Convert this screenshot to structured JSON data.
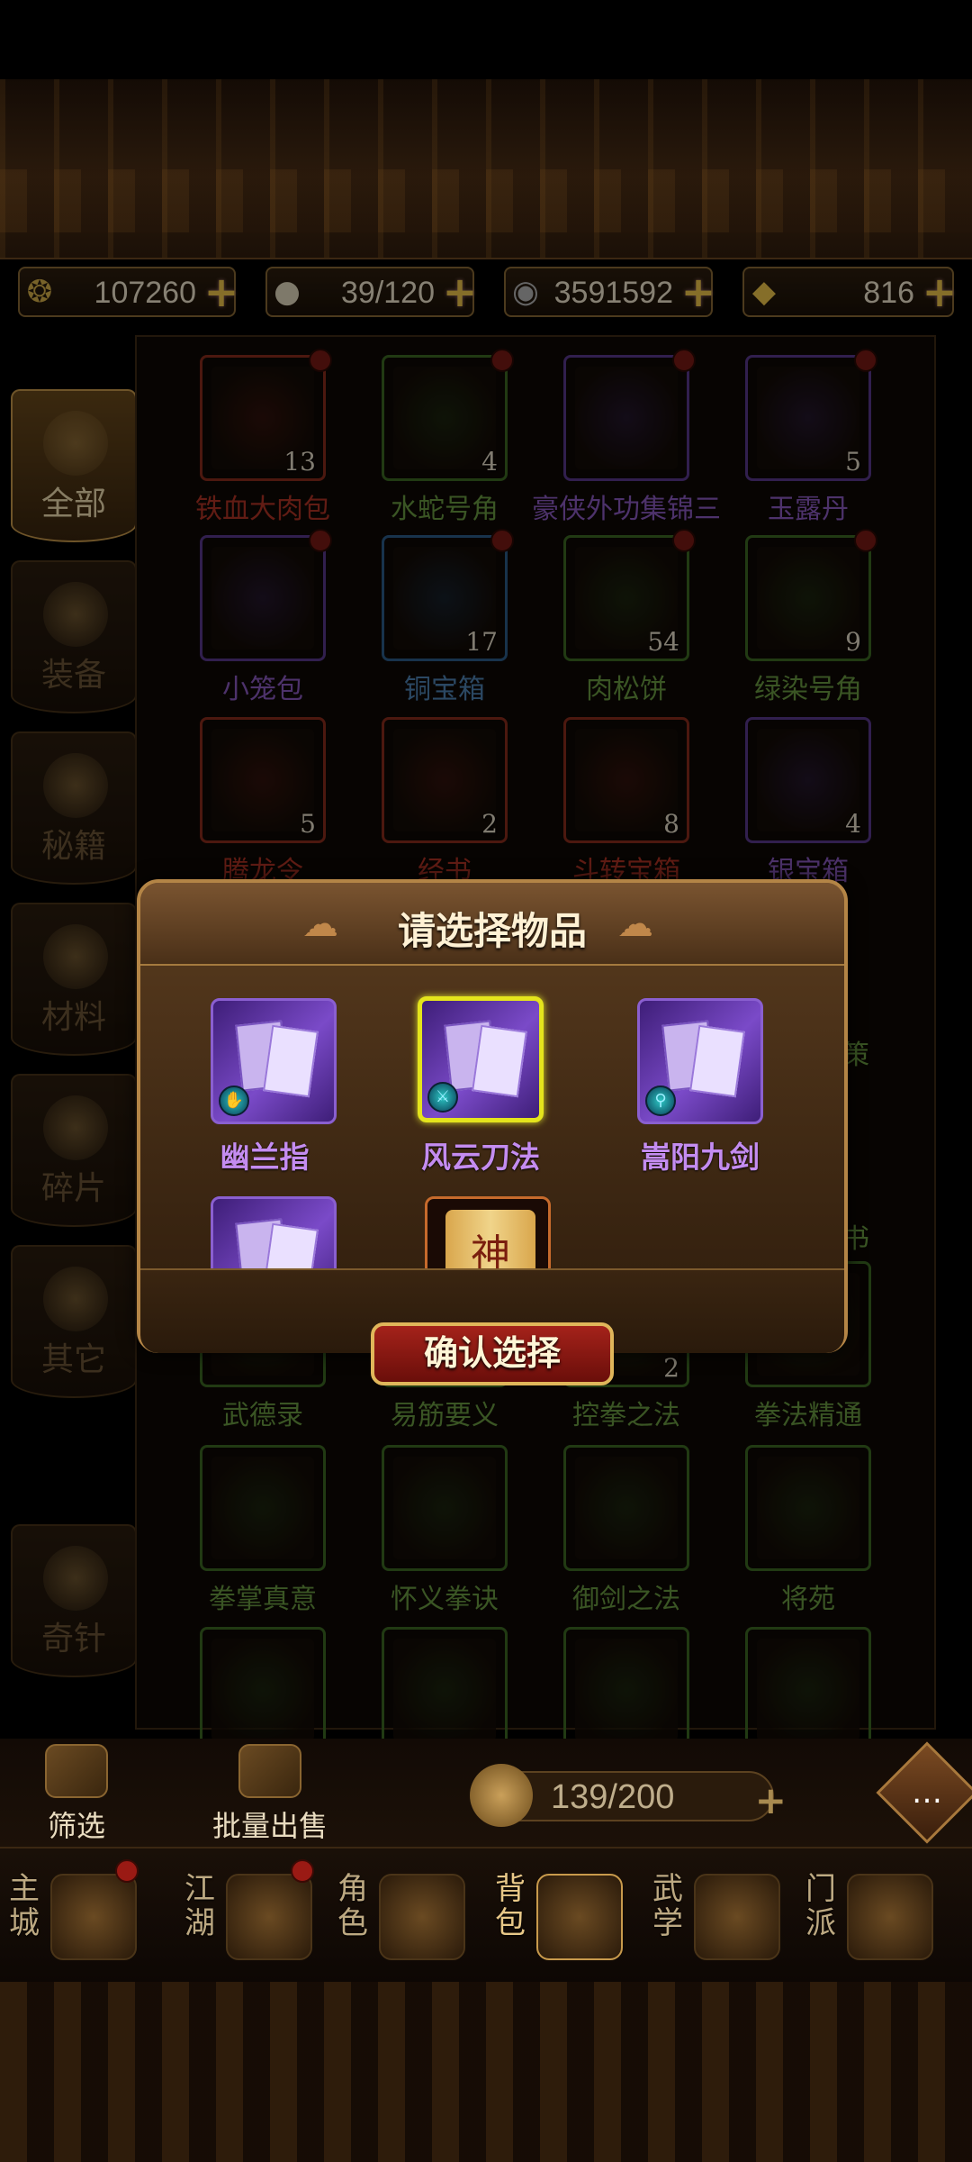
{
  "resources": [
    {
      "icon": "jade-coin-icon",
      "value": "107260",
      "color": "#d9b24c"
    },
    {
      "icon": "bun-icon",
      "value": "39/120",
      "color": "#d7c9a8"
    },
    {
      "icon": "copper-coin-icon",
      "value": "3591592",
      "color": "#b8b8b8"
    },
    {
      "icon": "gold-ingot-icon",
      "value": "816",
      "color": "#f2c94c"
    }
  ],
  "sidebar": {
    "tabs": [
      {
        "label": "全部",
        "active": true
      },
      {
        "label": "装备"
      },
      {
        "label": "秘籍"
      },
      {
        "label": "材料"
      },
      {
        "label": "碎片"
      },
      {
        "label": "其它"
      },
      {
        "label": "奇针"
      }
    ]
  },
  "grid": {
    "items": [
      {
        "name": "铁血大肉包",
        "count": "13",
        "rarity": "red",
        "dot": true
      },
      {
        "name": "水蛇号角",
        "count": "4",
        "rarity": "green",
        "dot": true
      },
      {
        "name": "豪侠外功集锦三",
        "count": "",
        "rarity": "purple",
        "dot": true
      },
      {
        "name": "玉露丹",
        "count": "5",
        "rarity": "purple",
        "dot": true
      },
      {
        "name": "小笼包",
        "count": "",
        "rarity": "purple",
        "dot": true
      },
      {
        "name": "铜宝箱",
        "count": "17",
        "rarity": "blue",
        "dot": true
      },
      {
        "name": "肉松饼",
        "count": "54",
        "rarity": "green",
        "dot": true
      },
      {
        "name": "绿染号角",
        "count": "9",
        "rarity": "green",
        "dot": true
      },
      {
        "name": "腾龙令",
        "count": "5",
        "rarity": "red",
        "dot": false
      },
      {
        "name": "经书",
        "count": "2",
        "rarity": "red",
        "dot": false
      },
      {
        "name": "斗转宝箱",
        "count": "8",
        "rarity": "red",
        "dot": false
      },
      {
        "name": "银宝箱",
        "count": "4",
        "rarity": "purple",
        "dot": false
      },
      {
        "name": "武德录",
        "count": "",
        "rarity": "green",
        "dot": false
      },
      {
        "name": "易筋要义",
        "count": "",
        "rarity": "green",
        "dot": false
      },
      {
        "name": "控拳之法",
        "count": "2",
        "rarity": "green",
        "dot": false
      },
      {
        "name": "拳法精通",
        "count": "",
        "rarity": "green",
        "dot": false
      },
      {
        "name": "拳掌真意",
        "count": "",
        "rarity": "green",
        "dot": false
      },
      {
        "name": "怀义拳诀",
        "count": "",
        "rarity": "green",
        "dot": false
      },
      {
        "name": "御剑之法",
        "count": "",
        "rarity": "green",
        "dot": false
      },
      {
        "name": "将苑",
        "count": "",
        "rarity": "green",
        "dot": false
      },
      {
        "name": "",
        "count": "",
        "rarity": "green",
        "dot": false
      },
      {
        "name": "",
        "count": "",
        "rarity": "green",
        "dot": false
      },
      {
        "name": "",
        "count": "",
        "rarity": "green",
        "dot": false
      },
      {
        "name": "",
        "count": "",
        "rarity": "green",
        "dot": false
      }
    ],
    "partial_labels": [
      "策",
      "书"
    ]
  },
  "dialog": {
    "title": "请选择物品",
    "items": [
      {
        "name": "幽兰指",
        "type": "book",
        "selected": false
      },
      {
        "name": "风云刀法",
        "type": "book",
        "selected": true
      },
      {
        "name": "嵩阳九剑",
        "type": "book",
        "selected": false
      },
      {
        "name": "",
        "type": "book",
        "selected": false
      },
      {
        "name": "",
        "type": "scroll",
        "selected": false,
        "glyph": "神"
      }
    ],
    "confirm_label": "确认选择"
  },
  "bottom": {
    "filter_label": "筛选",
    "sell_label": "批量出售",
    "capacity": "139/200",
    "plus": "+",
    "chat_icon": "chat-bubble-icon"
  },
  "nav": [
    {
      "label": "主城",
      "dot": true,
      "active": false
    },
    {
      "label": "江湖",
      "dot": true,
      "active": false
    },
    {
      "label": "角色",
      "dot": false,
      "active": false
    },
    {
      "label": "背包",
      "dot": false,
      "active": true
    },
    {
      "label": "武学",
      "dot": false,
      "active": false
    },
    {
      "label": "门派",
      "dot": false,
      "active": false
    }
  ]
}
